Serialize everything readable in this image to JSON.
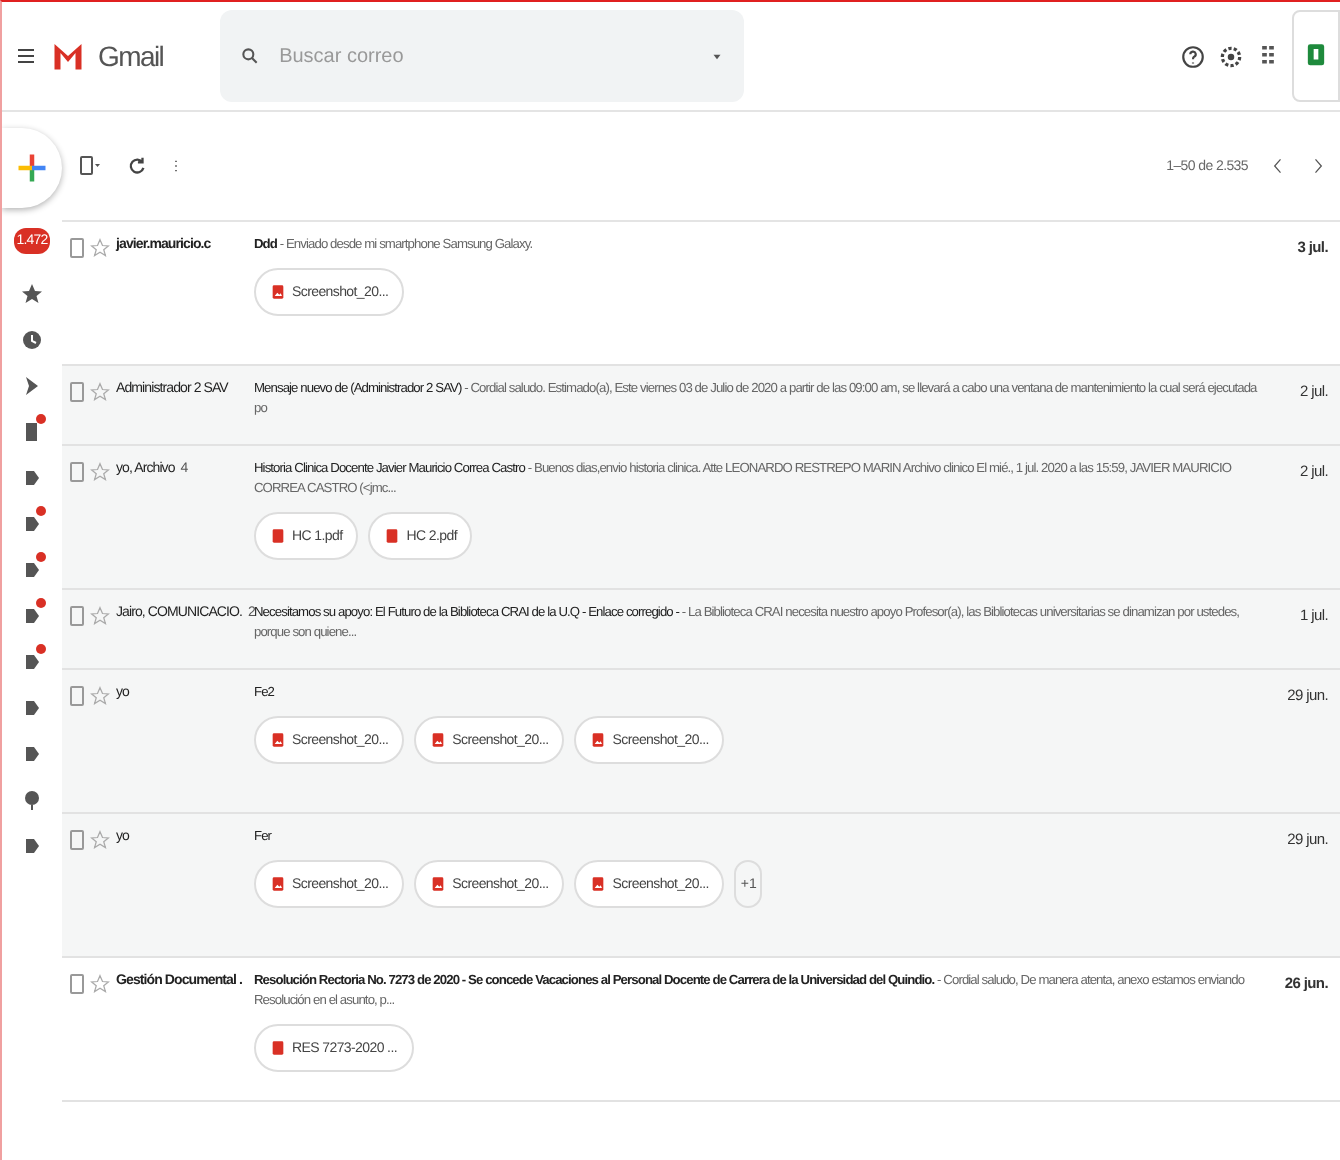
{
  "header": {
    "product": "Gmail",
    "search": {
      "placeholder": "Buscar correo"
    }
  },
  "sidebar": {
    "inbox_count": "1.472",
    "items": [
      {
        "kind": "star",
        "dot": false
      },
      {
        "kind": "clock",
        "dot": false
      },
      {
        "kind": "send",
        "dot": false
      },
      {
        "kind": "file",
        "dot": true
      },
      {
        "kind": "label",
        "dot": false
      },
      {
        "kind": "label",
        "dot": true
      },
      {
        "kind": "label",
        "dot": true
      },
      {
        "kind": "label",
        "dot": true
      },
      {
        "kind": "label",
        "dot": true
      },
      {
        "kind": "label",
        "dot": false
      },
      {
        "kind": "label",
        "dot": false
      },
      {
        "kind": "pin",
        "dot": false
      },
      {
        "kind": "label",
        "dot": false
      }
    ]
  },
  "toolbar": {
    "range": "1–50 de 2.535"
  },
  "emails": [
    {
      "read": false,
      "sender": "javier.mauricio.c",
      "subject": "Ddd",
      "snippet": " - Enviado desde mi smartphone Samsung Galaxy.",
      "date": "3 jul.",
      "attachments": [
        {
          "kind": "image",
          "name": "Screenshot_20..."
        }
      ]
    },
    {
      "read": true,
      "sender": "Administrador 2 SAV",
      "subject": "Mensaje nuevo de (Administrador 2 SAV)",
      "snippet": " - Cordial saludo. Estimado(a), Este viernes 03 de Julio de 2020 a partir de las 09:00 am, se llevará a cabo una ventana de mantenimiento la cual será ejecutada po",
      "date": "2 jul."
    },
    {
      "read": true,
      "sender": "yo, Archivo",
      "count": "4",
      "subject": "Historia Clinica Docente Javier Mauricio Correa Castro",
      "snippet": " - Buenos dias,envio historia clinica. Atte LEONARDO RESTREPO MARIN Archivo clinico El mié., 1 jul. 2020 a las 15:59, JAVIER MAURICIO CORREA CASTRO (<jmc...",
      "date": "2 jul.",
      "attachments": [
        {
          "kind": "pdf",
          "name": "HC 1.pdf"
        },
        {
          "kind": "pdf",
          "name": "HC 2.pdf"
        }
      ]
    },
    {
      "read": true,
      "sender": "Jairo, COMUNICACIO.",
      "count": "2",
      "subject": "Necesitamos su apoyo: El Futuro de la Biblioteca CRAI de la U.Q - Enlace corregido -",
      "snippet": " - La Biblioteca CRAI necesita nuestro apoyo Profesor(a), las Bibliotecas universitarias se dinamizan por ustedes, porque son quiene...",
      "date": "1 jul."
    },
    {
      "read": true,
      "sender": "yo",
      "subject": "Fe2",
      "date": "29 jun.",
      "attachments": [
        {
          "kind": "image",
          "name": "Screenshot_20..."
        },
        {
          "kind": "image",
          "name": "Screenshot_20..."
        },
        {
          "kind": "image",
          "name": "Screenshot_20..."
        }
      ]
    },
    {
      "read": true,
      "sender": "yo",
      "subject": "Fer",
      "date": "29 jun.",
      "attachments": [
        {
          "kind": "image",
          "name": "Screenshot_20..."
        },
        {
          "kind": "image",
          "name": "Screenshot_20..."
        },
        {
          "kind": "image",
          "name": "Screenshot_20..."
        }
      ],
      "more": "+1"
    },
    {
      "read": false,
      "sender": "Gestión Documental .",
      "subject": "Resolución Rectoria No. 7273 de 2020 - Se concede Vacaciones al Personal Docente de Carrera de la Universidad del Quindio.",
      "snippet": " - Cordial saludo, De manera atenta, anexo estamos enviando Resolución en el asunto, p...",
      "date": "26 jun.",
      "attachments": [
        {
          "kind": "pdf",
          "name": "RES 7273-2020 ..."
        }
      ]
    }
  ]
}
